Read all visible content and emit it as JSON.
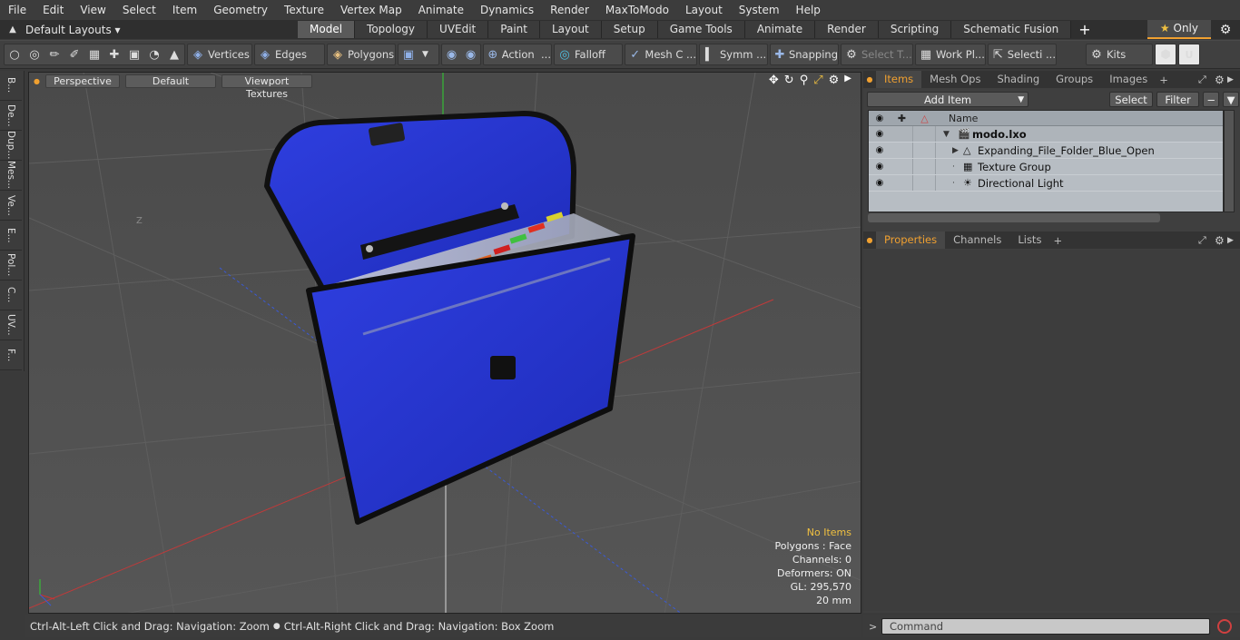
{
  "menu": [
    "File",
    "Edit",
    "View",
    "Select",
    "Item",
    "Geometry",
    "Texture",
    "Vertex Map",
    "Animate",
    "Dynamics",
    "Render",
    "MaxToModo",
    "Layout",
    "System",
    "Help"
  ],
  "layout_selector": "Default Layouts",
  "tabs": [
    "Model",
    "Topology",
    "UVEdit",
    "Paint",
    "Layout",
    "Setup",
    "Game Tools",
    "Animate",
    "Render",
    "Scripting",
    "Schematic Fusion"
  ],
  "active_tab": "Model",
  "only_label": "Only",
  "toolbar": {
    "vertices": "Vertices",
    "edges": "Edges",
    "polygons": "Polygons",
    "action": "Action",
    "falloff": "Falloff",
    "mesh": "Mesh C ...",
    "symm": "Symm ...",
    "snapping": "Snapping",
    "select_t": "Select T...",
    "work_plane": "Work Pl...",
    "selecti": "Selecti ...",
    "kits": "Kits"
  },
  "left_strip": [
    "B...",
    "De...",
    "Dup...",
    "Mes...",
    "Ve...",
    "E...",
    "Pol...",
    "C...",
    "UV...",
    "F..."
  ],
  "viewport": {
    "perspective": "Perspective",
    "default": "Default",
    "textures": "Viewport Textures",
    "axis_label": "Z",
    "info": {
      "no_items": "No Items",
      "polygons": "Polygons : Face",
      "channels": "Channels: 0",
      "deformers": "Deformers: ON",
      "gl": "GL: 295,570",
      "scale": "20 mm"
    }
  },
  "status": {
    "left": "Ctrl-Alt-Left Click and Drag: Navigation: Zoom",
    "right": "Ctrl-Alt-Right Click and Drag: Navigation: Box Zoom"
  },
  "items_panel": {
    "tabs": [
      "Items",
      "Mesh Ops",
      "Shading",
      "Groups",
      "Images"
    ],
    "active": "Items",
    "add_item": "Add Item",
    "select": "Select",
    "filter": "Filter",
    "col_name": "Name",
    "rows": [
      {
        "name": "modo.lxo",
        "bold": true
      },
      {
        "name": "Expanding_File_Folder_Blue_Open"
      },
      {
        "name": "Texture Group"
      },
      {
        "name": "Directional Light"
      }
    ]
  },
  "props_panel": {
    "tabs": [
      "Properties",
      "Channels",
      "Lists"
    ],
    "active": "Properties"
  },
  "command_placeholder": "Command"
}
